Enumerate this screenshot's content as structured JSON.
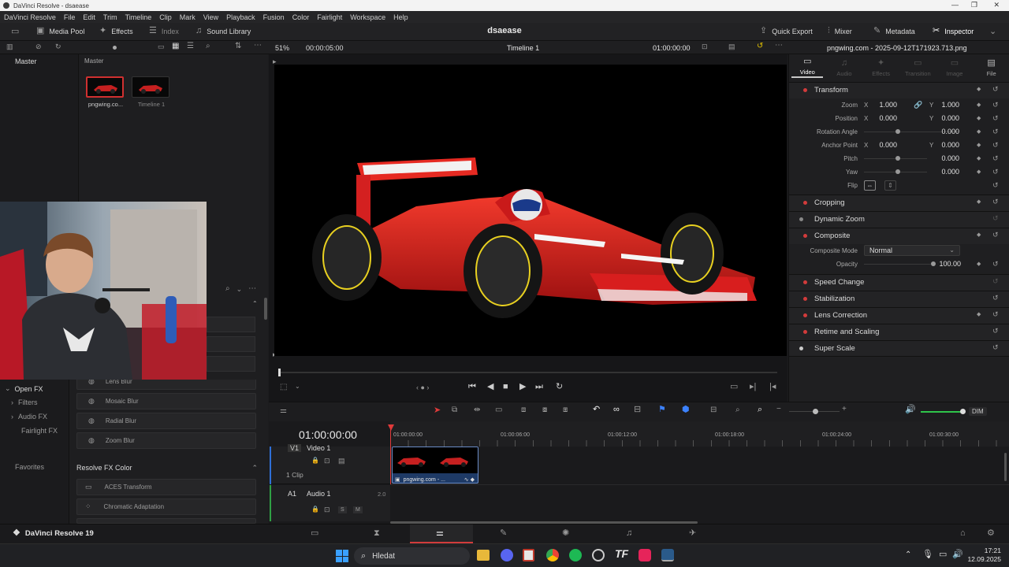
{
  "window": {
    "title": "DaVinci Resolve - dsaease"
  },
  "menu": [
    "DaVinci Resolve",
    "File",
    "Edit",
    "Trim",
    "Timeline",
    "Clip",
    "Mark",
    "View",
    "Playback",
    "Fusion",
    "Color",
    "Fairlight",
    "Workspace",
    "Help"
  ],
  "toolbar": {
    "media_pool": "Media Pool",
    "effects": "Effects",
    "index": "Index",
    "sound_library": "Sound Library",
    "project_name": "dsaease",
    "quick_export": "Quick Export",
    "mixer": "Mixer",
    "metadata": "Metadata",
    "inspector": "Inspector"
  },
  "subbar": {
    "zoom": "51%",
    "duration": "00:00:05:00",
    "timeline_name": "Timeline 1",
    "timecode": "01:00:00:00",
    "clip_name": "pngwing.com - 2025-09-12T171923.713.png"
  },
  "media_pool": {
    "bin": "Master",
    "items": [
      {
        "label": "pngwing.co..."
      },
      {
        "label": "Timeline 1"
      }
    ]
  },
  "effects": {
    "tree": {
      "open_fx": "Open FX",
      "filters": "Filters",
      "audio_fx": "Audio FX",
      "fairlight_fx": "Fairlight FX",
      "favorites": "Favorites"
    },
    "blur_items": [
      "Lens Blur",
      "Mosaic Blur",
      "Radial Blur",
      "Zoom Blur"
    ],
    "resolve_fx_color_title": "Resolve FX Color",
    "color_items": [
      "ACES Transform",
      "Chromatic Adaptation"
    ]
  },
  "inspector": {
    "tabs": [
      "Video",
      "Audio",
      "Effects",
      "Transition",
      "Image",
      "File"
    ],
    "transform_title": "Transform",
    "zoom": {
      "label": "Zoom",
      "x": "1.000",
      "y": "1.000"
    },
    "position": {
      "label": "Position",
      "x": "0.000",
      "y": "0.000"
    },
    "rotation": {
      "label": "Rotation Angle",
      "value": "0.000"
    },
    "anchor": {
      "label": "Anchor Point",
      "x": "0.000",
      "y": "0.000"
    },
    "pitch": {
      "label": "Pitch",
      "value": "0.000"
    },
    "yaw": {
      "label": "Yaw",
      "value": "0.000"
    },
    "flip": "Flip",
    "axis_x": "X",
    "axis_y": "Y",
    "sections": [
      "Cropping",
      "Dynamic Zoom",
      "Composite"
    ],
    "composite_mode_label": "Composite Mode",
    "composite_mode": "Normal",
    "opacity_label": "Opacity",
    "opacity": "100.00",
    "sections2": [
      "Speed Change",
      "Stabilization",
      "Lens Correction",
      "Retime and Scaling",
      "Super Scale"
    ]
  },
  "timeline": {
    "timecode": "01:00:00:00",
    "ruler": [
      "01:00:00:00",
      "01:00:06:00",
      "01:00:12:00",
      "01:00:18:00",
      "01:00:24:00",
      "01:00:30:00"
    ],
    "video_track": {
      "id": "V1",
      "name": "Video 1",
      "clips": "1 Clip"
    },
    "audio_track": {
      "id": "A1",
      "name": "Audio 1",
      "level": "2.0"
    },
    "clip_label": "pngwing.com - ...",
    "dim": "DIM"
  },
  "pagebar": {
    "app": "DaVinci Resolve 19"
  },
  "taskbar": {
    "search": "Hledat",
    "time": "17:21",
    "date": "12.09.2025"
  }
}
